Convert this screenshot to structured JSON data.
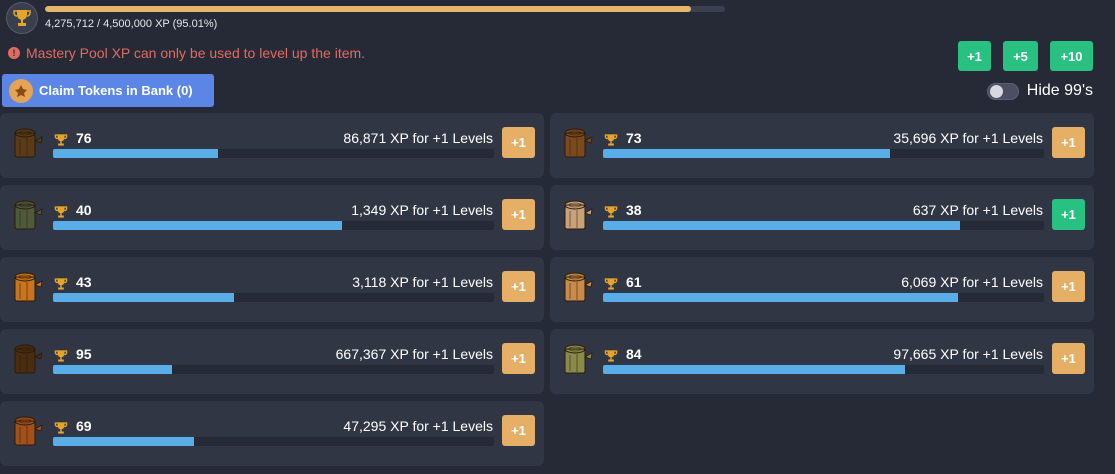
{
  "mastery_pool": {
    "progress_text": "4,275,712 / 4,500,000 XP (95.01%)",
    "progress_fraction": 0.9501,
    "icon": "trophy-icon"
  },
  "warning_text": "Mastery Pool XP can only be used to level up the item.",
  "spend_buttons": [
    "+1",
    "+5",
    "+10"
  ],
  "claim_button_label": "Claim Tokens in Bank (0)",
  "hide_99_label": "Hide 99's",
  "hide_99_enabled": false,
  "colors": {
    "background": "#262a36",
    "card": "#313645",
    "progress": "#5aaee8",
    "pool_progress": "#e5b66c",
    "level_button": "#e5b066",
    "green_button": "#29c182",
    "claim_button": "#5b86e5",
    "warning": "#e26a5f"
  },
  "items": [
    {
      "icon": "normal-log-icon",
      "log_color": "#5a3a18",
      "level": "76",
      "xp_text": "86,871 XP for +1 Levels",
      "progress": 0.375,
      "button": "+1",
      "button_affordable": false
    },
    {
      "icon": "oak-log-icon",
      "log_color": "#7a4a1c",
      "level": "73",
      "xp_text": "35,696 XP for +1 Levels",
      "progress": 0.65,
      "button": "+1",
      "button_affordable": false
    },
    {
      "icon": "willow-log-icon",
      "log_color": "#4e5a3c",
      "level": "40",
      "xp_text": "1,349 XP for +1 Levels",
      "progress": 0.655,
      "button": "+1",
      "button_affordable": false
    },
    {
      "icon": "teak-log-icon",
      "log_color": "#c9a27a",
      "level": "38",
      "xp_text": "637 XP for +1 Levels",
      "progress": 0.81,
      "button": "+1",
      "button_affordable": true
    },
    {
      "icon": "maple-log-icon",
      "log_color": "#c9741e",
      "level": "43",
      "xp_text": "3,118 XP for +1 Levels",
      "progress": 0.41,
      "button": "+1",
      "button_affordable": false
    },
    {
      "icon": "mahogany-log-icon",
      "log_color": "#c98a4a",
      "level": "61",
      "xp_text": "6,069 XP for +1 Levels",
      "progress": 0.805,
      "button": "+1",
      "button_affordable": false
    },
    {
      "icon": "yew-log-icon",
      "log_color": "#4a2c10",
      "level": "95",
      "xp_text": "667,367 XP for +1 Levels",
      "progress": 0.27,
      "button": "+1",
      "button_affordable": false
    },
    {
      "icon": "magic-log-icon",
      "log_color": "#8a8a4a",
      "level": "84",
      "xp_text": "97,665 XP for +1 Levels",
      "progress": 0.685,
      "button": "+1",
      "button_affordable": false
    },
    {
      "icon": "redwood-log-icon",
      "log_color": "#a2501c",
      "level": "69",
      "xp_text": "47,295 XP for +1 Levels",
      "progress": 0.32,
      "button": "+1",
      "button_affordable": false
    }
  ]
}
